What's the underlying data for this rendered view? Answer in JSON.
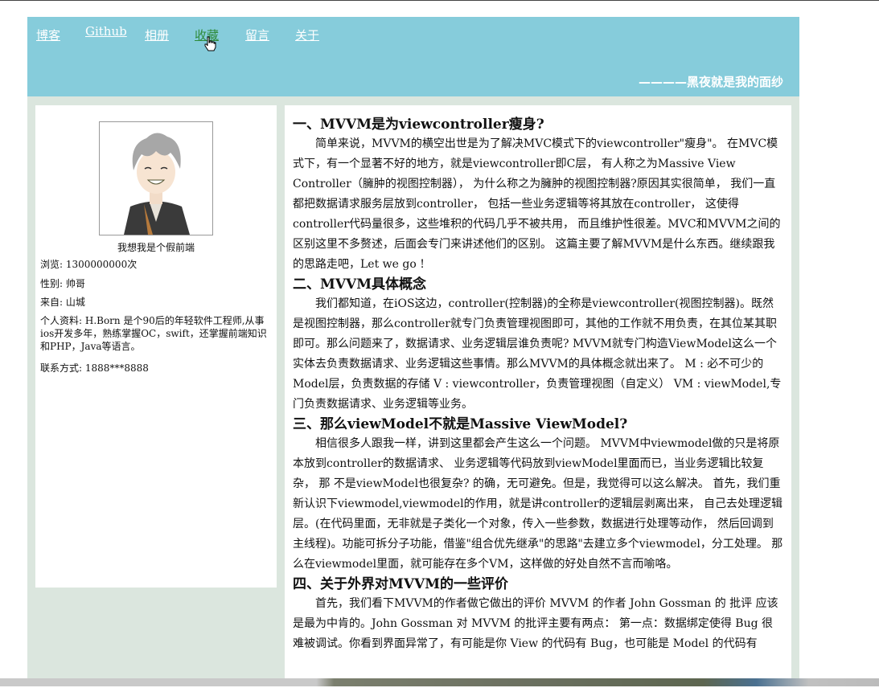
{
  "nav": {
    "items": [
      "博客",
      "Github",
      "相册",
      "收藏",
      "留言",
      "关于"
    ],
    "active": "收藏"
  },
  "motto": "————黑夜就是我的面纱",
  "profile": {
    "nickname": "我想我是个假前端",
    "views": "浏览: 1300000000次",
    "gender": "性别: 帅哥",
    "origin": "来自:  山城",
    "bio": "个人资料: H.Born 是个90后的年轻软件工程师,从事ios开发多年，熟练掌握OC，swift，还掌握前端知识和PHP，Java等语言。",
    "contact": "联系方式: 1888***8888"
  },
  "article": {
    "sections": [
      {
        "title": "一、MVVM是为viewcontroller瘦身?",
        "body": "简单来说，MVVM的横空出世是为了解决MVC模式下的viewcontroller\"瘦身\"。 在MVC模式下，有一个显著不好的地方，就是viewcontroller即C层， 有人称之为Massive View Controller（臃肿的视图控制器）， 为什么称之为臃肿的视图控制器?原因其实很简单， 我们一直都把数据请求服务层放到controller， 包括一些业务逻辑等将其放在controller， 这使得controller代码量很多，这些堆积的代码几乎不被共用， 而且维护性很差。MVC和MVVM之间的区别这里不多赘述，后面会专门来讲述他们的区别。 这篇主要了解MVVM是什么东西。继续跟我的思路走吧，Let we go !"
      },
      {
        "title": "二、MVVM具体概念",
        "body": "我们都知道，在iOS这边，controller(控制器)的全称是viewcontroller(视图控制器)。既然是视图控制器，那么controller就专门负责管理视图即可，其他的工作就不用负责，在其位某其职即可。那么问题来了，数据请求、业务逻辑层谁负责呢? MVVM就专门构造ViewModel这么一个实体去负责数据请求、业务逻辑这些事情。那么MVVM的具体概念就出来了。 M : 必不可少的Model层，负责数据的存储 V :  viewcontroller，负责管理视图（自定义） VM : viewModel,专门负责数据请求、业务逻辑等业务。"
      },
      {
        "title": "三、那么viewModel不就是Massive ViewModel?",
        "body": "相信很多人跟我一样，讲到这里都会产生这么一个问题。 MVVM中viewmodel做的只是将原本放到controller的数据请求、 业务逻辑等代码放到viewModel里面而已，当业务逻辑比较复杂， 那 不是viewModel也很复杂? 的确，无可避免。但是，我觉得可以这么解决。 首先，我们重新认识下viewmodel,viewmodel的作用，就是讲controller的逻辑层剥离出来， 自己去处理逻辑层。(在代码里面，无非就是子类化一个对象，传入一些参数，数据进行处理等动作， 然后回调到主线程)。功能可拆分子功能，借鉴\"组合优先继承\"的思路\"去建立多个viewmodel，分工处理。 那么在viewmodel里面，就可能存在多个VM，这样做的好处自然不言而喻咯。"
      },
      {
        "title": "四、关于外界对MVVM的一些评价",
        "body": "首先，我们看下MVVM的作者做它做出的评价 MVVM 的作者 John Gossman 的 批评 应该是最为中肯的。John Gossman 对 MVVM 的批评主要有两点： 第一点：数据绑定使得 Bug 很难被调试。你看到界面异常了，有可能是你 View 的代码有 Bug，也可能是 Model 的代码有"
      }
    ]
  }
}
